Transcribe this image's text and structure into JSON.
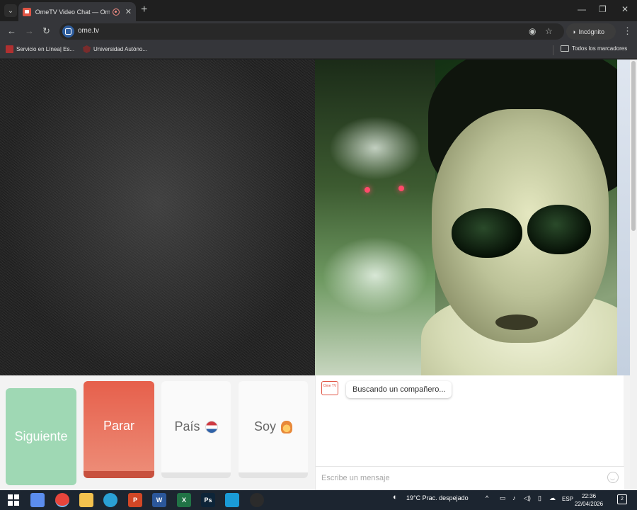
{
  "browser": {
    "tab_title": "OmeTV Video Chat — Ome",
    "tab_close": "✕",
    "new_tab": "+",
    "window_controls": {
      "minimize": "—",
      "maximize": "❐",
      "close": "✕"
    },
    "back": "←",
    "forward": "→",
    "reload": "↻",
    "url": "ome.tv",
    "incognito_label": "Incógnito",
    "menu": "⋮"
  },
  "bookmarks": {
    "items": [
      {
        "label": "Servicio en Línea| Es...",
        "icon": "sil-favicon"
      },
      {
        "label": "Universidad Autóno...",
        "icon": "university-shield-icon"
      }
    ],
    "all_bookmarks_label": "Todos los marcadores"
  },
  "controls": {
    "next_label": "Siguiente",
    "stop_label": "Parar",
    "country_label": "País",
    "country_flag": "netherlands-flag",
    "gender_label": "Soy",
    "gender_icon": "woman-emoji"
  },
  "chat": {
    "logo_text": "Ome TV",
    "status_message": "Buscando un compañero...",
    "input_placeholder": "Escribe un mensaje"
  },
  "taskbar": {
    "apps": [
      {
        "name": "copilot-icon",
        "color": "#5b8def"
      },
      {
        "name": "chrome-icon",
        "color": "#e8453c",
        "active": true
      },
      {
        "name": "file-explorer-icon",
        "color": "#f2c14e"
      },
      {
        "name": "edge-icon",
        "color": "#2aa1d6"
      },
      {
        "name": "powerpoint-icon",
        "color": "#d24726",
        "glyph": "P"
      },
      {
        "name": "word-icon",
        "color": "#2b579a",
        "glyph": "W"
      },
      {
        "name": "excel-icon",
        "color": "#217346",
        "glyph": "X"
      },
      {
        "name": "photoshop-icon",
        "color": "#0d2438",
        "glyph": "Ps"
      },
      {
        "name": "store-icon",
        "color": "#1a9bd7"
      },
      {
        "name": "obs-icon",
        "color": "#2b2b2b"
      }
    ],
    "weather": "19°C  Prac. despejado",
    "language": "ESP",
    "time": "22:36",
    "date": "22/04/2026",
    "notifications": "2"
  },
  "colors": {
    "next_button": "#9fd8b4",
    "stop_button": "#e6604c",
    "brand": "#e05545"
  }
}
